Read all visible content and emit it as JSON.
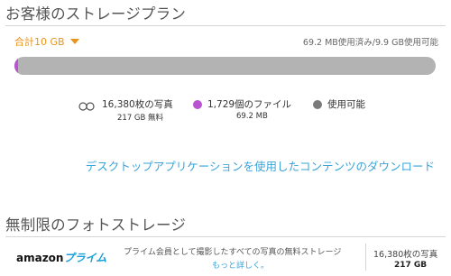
{
  "storage": {
    "title": "お客様のストレージプラン",
    "total_label": "合計10 GB",
    "usage_text": "69.2 MB使用済み/9.9 GB使用可能",
    "used_fraction": 0.007,
    "legend": {
      "photos_label": "16,380枚の写真",
      "photos_sub": "217 GB 無料",
      "files_label": "1,729個のファイル",
      "files_sub": "69.2 MB",
      "available_label": "使用可能"
    },
    "download_link": "デスクトップアプリケーションを使用したコンテンツのダウンロード"
  },
  "photo_storage": {
    "title": "無制限のフォトストレージ",
    "logo_amazon": "amazon",
    "logo_prime": "プライム",
    "description": "プライム会員として撮影したすべての写真の無料ストレージ",
    "learn_more": "もっと詳しく。",
    "photo_count": "16,380枚の写真",
    "photo_size": "217 GB"
  },
  "colors": {
    "accent_orange": "#e8941c",
    "files_purple": "#b954d0",
    "available_gray": "#7a7a7a",
    "link_blue": "#3aa3d8"
  },
  "icons": {
    "photos": "infinity-icon",
    "total_dropdown": "caret-down-icon"
  }
}
